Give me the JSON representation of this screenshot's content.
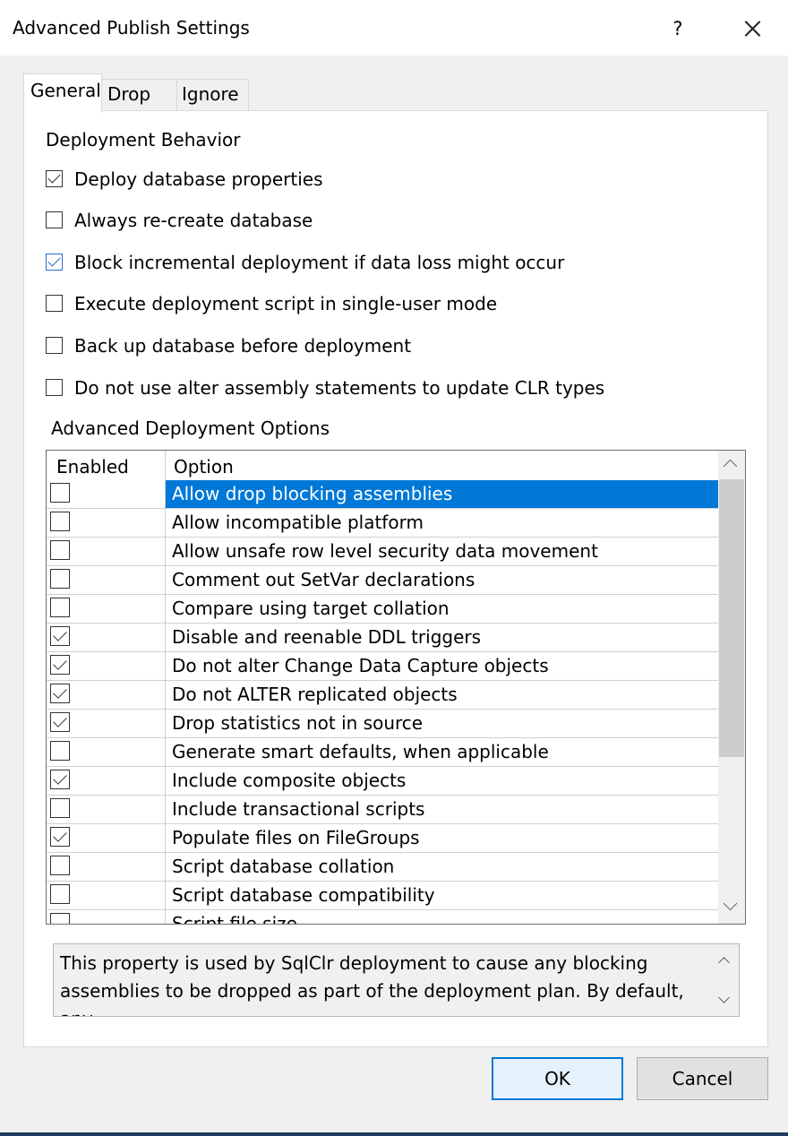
{
  "dialog": {
    "title": "Advanced Publish Settings",
    "help_label": "?",
    "close_label": "×"
  },
  "tabs": [
    {
      "label": "General",
      "selected": true
    },
    {
      "label": "Drop",
      "selected": false
    },
    {
      "label": "Ignore",
      "selected": false
    }
  ],
  "deployment_behavior": {
    "heading": "Deployment Behavior",
    "options": [
      {
        "label": "Deploy database properties",
        "checked": true
      },
      {
        "label": "Always re-create database",
        "checked": false
      },
      {
        "label": "Block incremental deployment if data loss might occur",
        "checked": true
      },
      {
        "label": "Execute deployment script in single-user mode",
        "checked": false
      },
      {
        "label": "Back up database before deployment",
        "checked": false
      },
      {
        "label": "Do not use alter assembly statements to update CLR types",
        "checked": false
      }
    ]
  },
  "advanced": {
    "heading": "Advanced Deployment Options",
    "columns": [
      "Enabled",
      "Option"
    ],
    "rows": [
      {
        "option": "Allow drop blocking assemblies",
        "enabled": false,
        "selected": true
      },
      {
        "option": "Allow incompatible platform",
        "enabled": false
      },
      {
        "option": "Allow unsafe row level security data movement",
        "enabled": false
      },
      {
        "option": "Comment out SetVar declarations",
        "enabled": false
      },
      {
        "option": "Compare using target collation",
        "enabled": false
      },
      {
        "option": "Disable and reenable DDL triggers",
        "enabled": true
      },
      {
        "option": "Do not alter Change Data Capture objects",
        "enabled": true
      },
      {
        "option": "Do not ALTER replicated objects",
        "enabled": true
      },
      {
        "option": "Drop statistics not in source",
        "enabled": true
      },
      {
        "option": "Generate smart defaults, when applicable",
        "enabled": false
      },
      {
        "option": "Include composite objects",
        "enabled": true
      },
      {
        "option": "Include transactional scripts",
        "enabled": false
      },
      {
        "option": "Populate files on FileGroups",
        "enabled": true
      },
      {
        "option": "Script database collation",
        "enabled": false
      },
      {
        "option": "Script database compatibility",
        "enabled": false
      },
      {
        "option": "Script file size",
        "enabled": false
      }
    ]
  },
  "description": {
    "text": "This property is used by SqlClr deployment to cause any blocking assemblies to be dropped as part of the deployment plan. By default, any"
  },
  "buttons": {
    "ok_label": "OK",
    "cancel_label": "Cancel"
  },
  "colors": {
    "selection": "#0078d7",
    "ok_border": "#0078d7",
    "bottom_border": "#1f3b63"
  }
}
